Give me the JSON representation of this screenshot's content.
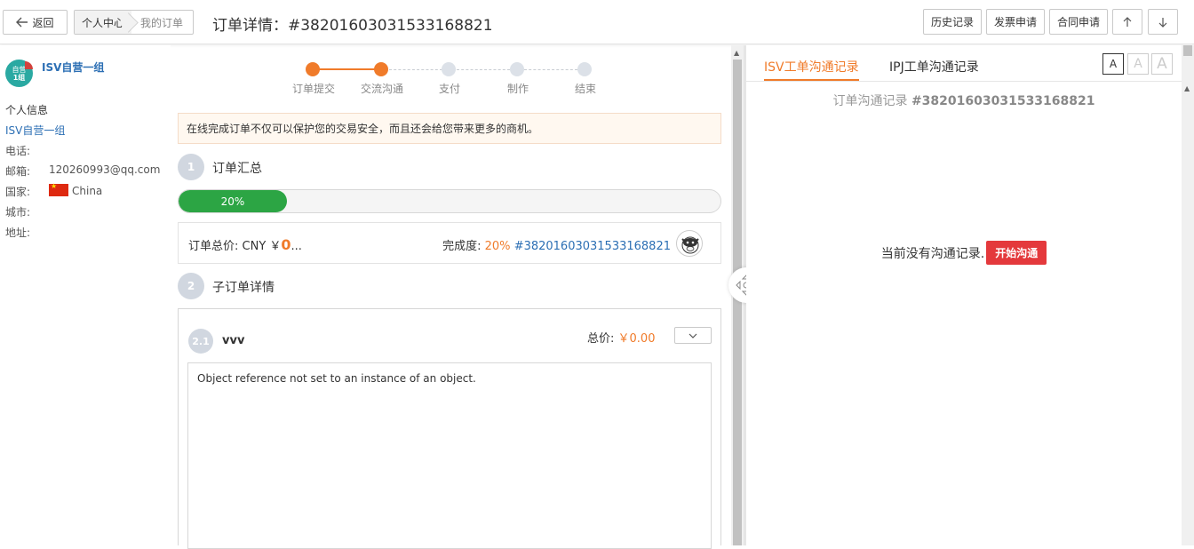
{
  "header": {
    "back_label": "返回",
    "breadcrumb": [
      "个人中心",
      "我的订单"
    ],
    "title": "订单详情：#38201603031533168821",
    "buttons": {
      "history": "历史记录",
      "invoice": "发票申请",
      "contract": "合同申请"
    }
  },
  "user": {
    "avatar_text_1": "自营",
    "avatar_text_2": "1组",
    "name": "ISV自营一组",
    "info_heading": "个人信息",
    "link_name": "ISV自营一组",
    "fields": {
      "phone_label": "电话:",
      "email_label": "邮箱:",
      "email_value": "120260993@qq.com",
      "country_label": "国家:",
      "country_value": "China",
      "city_label": "城市:",
      "address_label": "地址:"
    }
  },
  "steps": [
    {
      "label": "订单提交",
      "done": true
    },
    {
      "label": "交流沟通",
      "done": true
    },
    {
      "label": "支付",
      "done": false
    },
    {
      "label": "制作",
      "done": false
    },
    {
      "label": "结束",
      "done": false
    }
  ],
  "notice": "在线完成订单不仅可以保护您的交易安全，而且还会给您带来更多的商机。",
  "summary": {
    "section_number": "1",
    "section_title": "订单汇总",
    "progress_percent": 20,
    "progress_label": "20%",
    "total_label": "订单总价: CNY ￥",
    "total_amount": "0",
    "total_ellipsis": "...",
    "completion_label": "完成度:",
    "completion_value": "20%",
    "order_link": "#38201603031533168821"
  },
  "suborders": {
    "section_number": "2",
    "section_title": "子订单详情",
    "item": {
      "number": "2.1",
      "title": "vvv",
      "total_label": "总价:",
      "total_value": "￥0.00",
      "body": "Object reference not set to an instance of an object."
    }
  },
  "chat": {
    "tabs": [
      "ISV工单沟通记录",
      "IPJ工单沟通记录"
    ],
    "font_sizes": [
      "A",
      "A",
      "A"
    ],
    "heading_prefix": "订单沟通记录",
    "heading_id": "#38201603031533168821",
    "empty_text": "当前没有沟通记录.",
    "start_button": "开始沟通"
  },
  "colors": {
    "accent": "#f07b2a",
    "link": "#2c6fb4",
    "progress": "#2ca544",
    "danger": "#e4393c"
  },
  "icons": [
    "arrow-left-icon",
    "arrow-up-icon",
    "arrow-down-icon",
    "chevron-down-icon",
    "move-icon",
    "cow-logo-icon",
    "china-flag-icon"
  ]
}
